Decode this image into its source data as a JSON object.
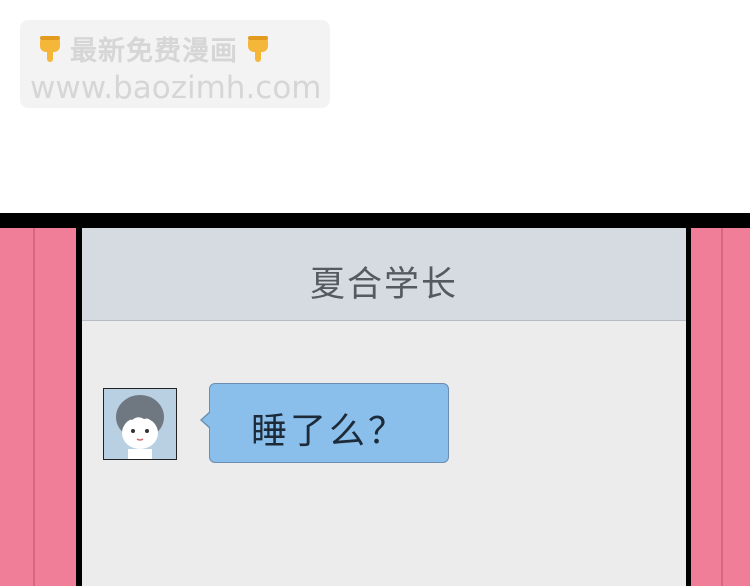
{
  "watermark": {
    "title": "最新免费漫画",
    "url": "www.baozimh.com",
    "left_icon": "pointing-down-hand-icon",
    "right_icon": "pointing-down-hand-icon"
  },
  "chat": {
    "contact_name": "夏合学长",
    "messages": [
      {
        "sender": "contact",
        "avatar_icon": "boy-avatar-icon",
        "text": "睡了么？"
      }
    ]
  },
  "colors": {
    "pink_wall": "#f07e98",
    "panel_border": "#000000",
    "header_bg": "#d5dbe1",
    "screen_bg": "#ececec",
    "bubble": "#8bbfeb"
  }
}
